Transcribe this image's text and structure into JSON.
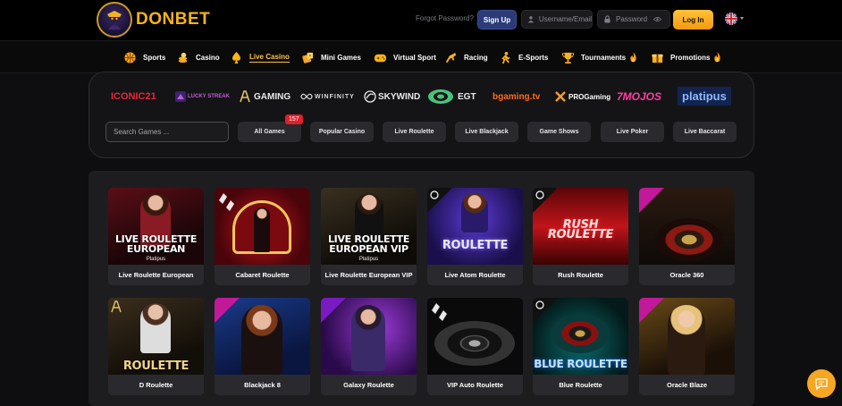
{
  "header": {
    "brand": "DONBET",
    "forgot_password": "Forgot Password?",
    "signup_label": "Sign Up",
    "username_placeholder": "Username/Email",
    "password_placeholder": "Password",
    "login_label": "Log In",
    "language_icon": "uk-flag-icon"
  },
  "nav": {
    "items": [
      {
        "label": "Sports",
        "icon": "basketball-icon"
      },
      {
        "label": "Casino",
        "icon": "coins-icon"
      },
      {
        "label": "Live Casino",
        "icon": "spade-icon",
        "active": true
      },
      {
        "label": "Mini Games",
        "icon": "dice-icon"
      },
      {
        "label": "Virtual Sport",
        "icon": "gamepad-icon"
      },
      {
        "label": "Racing",
        "icon": "horse-icon"
      },
      {
        "label": "E-Sports",
        "icon": "esports-icon"
      },
      {
        "label": "Tournaments",
        "icon": "trophy-icon",
        "hot": true
      },
      {
        "label": "Promotions",
        "icon": "gift-icon",
        "hot": true
      }
    ]
  },
  "providers": [
    {
      "label": "ICONIC21",
      "color": "#e8263a"
    },
    {
      "label": "LUCKY STREAK",
      "color": "#c25cd6"
    },
    {
      "label": "GAMING",
      "color": "#e9e9e9"
    },
    {
      "label": "WINFINITY",
      "color": "#dcdcdc"
    },
    {
      "label": "SKYWIND",
      "color": "#e9e9e9"
    },
    {
      "label": "EGT",
      "color": "#4bc27a"
    },
    {
      "label": "bgaming.tv",
      "color": "#ff6b1a"
    },
    {
      "label": "PROGaming",
      "color": "#ff9a2b"
    },
    {
      "label": "7MOJOS",
      "color": "#ff3fa0"
    },
    {
      "label": "platipus",
      "color": "#8fb8ff"
    }
  ],
  "filters": {
    "search_placeholder": "Search Games ...",
    "all_count": "157",
    "categories": [
      "All Games",
      "Popular Casino",
      "Live Roulette",
      "Live Blackjack",
      "Game Shows",
      "Live Poker",
      "Live Baccarat"
    ]
  },
  "games": [
    {
      "name": "Live Roulette European",
      "thumb_title": "LIVE ROULETTE EUROPEAN",
      "thumb_sub": "Platipus"
    },
    {
      "name": "Cabaret Roulette",
      "thumb_title": "",
      "thumb_sub": ""
    },
    {
      "name": "Live Roulette European VIP",
      "thumb_title": "LIVE ROULETTE EUROPEAN VIP",
      "thumb_sub": "Platipus"
    },
    {
      "name": "Live Atom Roulette",
      "thumb_title": "ROULETTE",
      "thumb_sub": ""
    },
    {
      "name": "Rush Roulette",
      "thumb_title": "RUSH ROULETTE",
      "thumb_sub": ""
    },
    {
      "name": "Oracle 360",
      "thumb_title": "",
      "thumb_sub": ""
    },
    {
      "name": "D Roulette",
      "thumb_title": "ROULETTE",
      "thumb_sub": ""
    },
    {
      "name": "Blackjack 8",
      "thumb_title": "",
      "thumb_sub": ""
    },
    {
      "name": "Galaxy Roulette",
      "thumb_title": "",
      "thumb_sub": ""
    },
    {
      "name": "VIP Auto Roulette",
      "thumb_title": "",
      "thumb_sub": ""
    },
    {
      "name": "Blue Roulette",
      "thumb_title": "BLUE ROULETTE",
      "thumb_sub": ""
    },
    {
      "name": "Oracle Blaze",
      "thumb_title": "",
      "thumb_sub": ""
    }
  ],
  "chat_icon": "chat-bubble-icon"
}
